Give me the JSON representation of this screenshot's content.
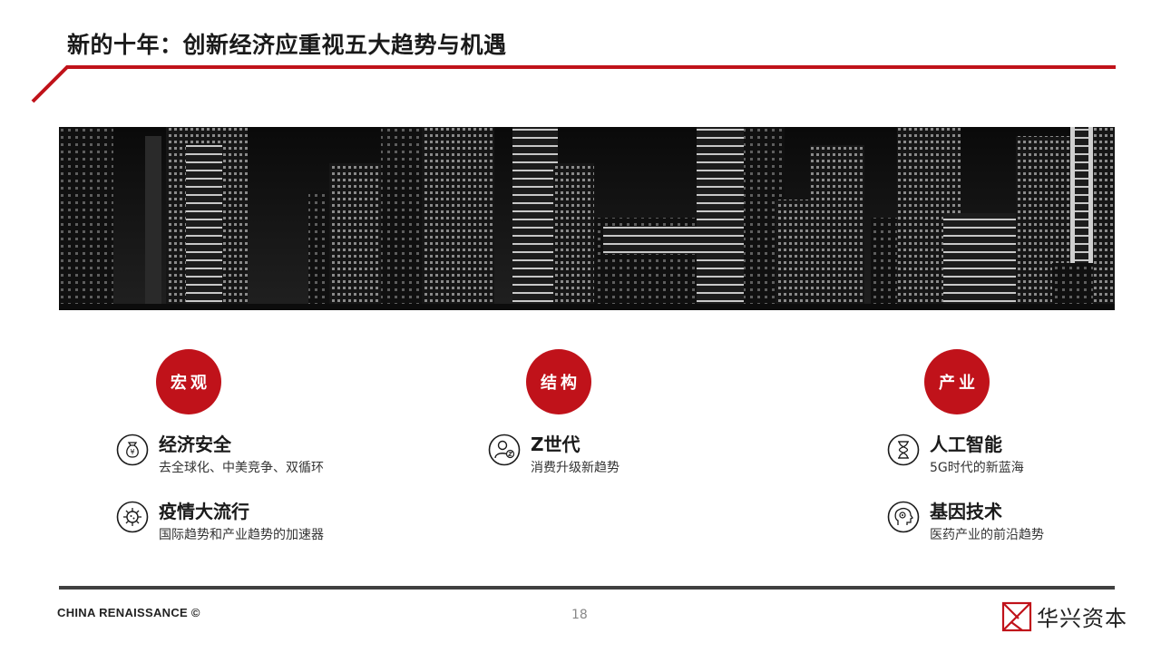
{
  "header": {
    "title": "新的十年：创新经济应重视五大趋势与机遇"
  },
  "categories": [
    {
      "label": "宏观"
    },
    {
      "label": "结构"
    },
    {
      "label": "产业"
    }
  ],
  "trends": {
    "economic_security": {
      "name": "经济安全",
      "desc": "去全球化、中美竞争、双循环",
      "icon": "money-bag-icon"
    },
    "pandemic": {
      "name": "疫情大流行",
      "desc": "国际趋势和产业趋势的加速器",
      "icon": "virus-icon"
    },
    "gen_z": {
      "name": "Z世代",
      "desc": "消费升级新趋势",
      "icon": "person-z-icon"
    },
    "ai": {
      "name": "人工智能",
      "desc": "5G时代的新蓝海",
      "icon": "hourglass-icon"
    },
    "gene_tech": {
      "name": "基因技术",
      "desc": "医药产业的前沿趋势",
      "icon": "head-gear-icon"
    }
  },
  "colors": {
    "accent": "#c0121a",
    "text": "#1a1a1a",
    "rule": "#404040"
  },
  "footer": {
    "left": "CHINA RENAISSANCE ©",
    "page": "18",
    "brand": "华兴资本"
  }
}
